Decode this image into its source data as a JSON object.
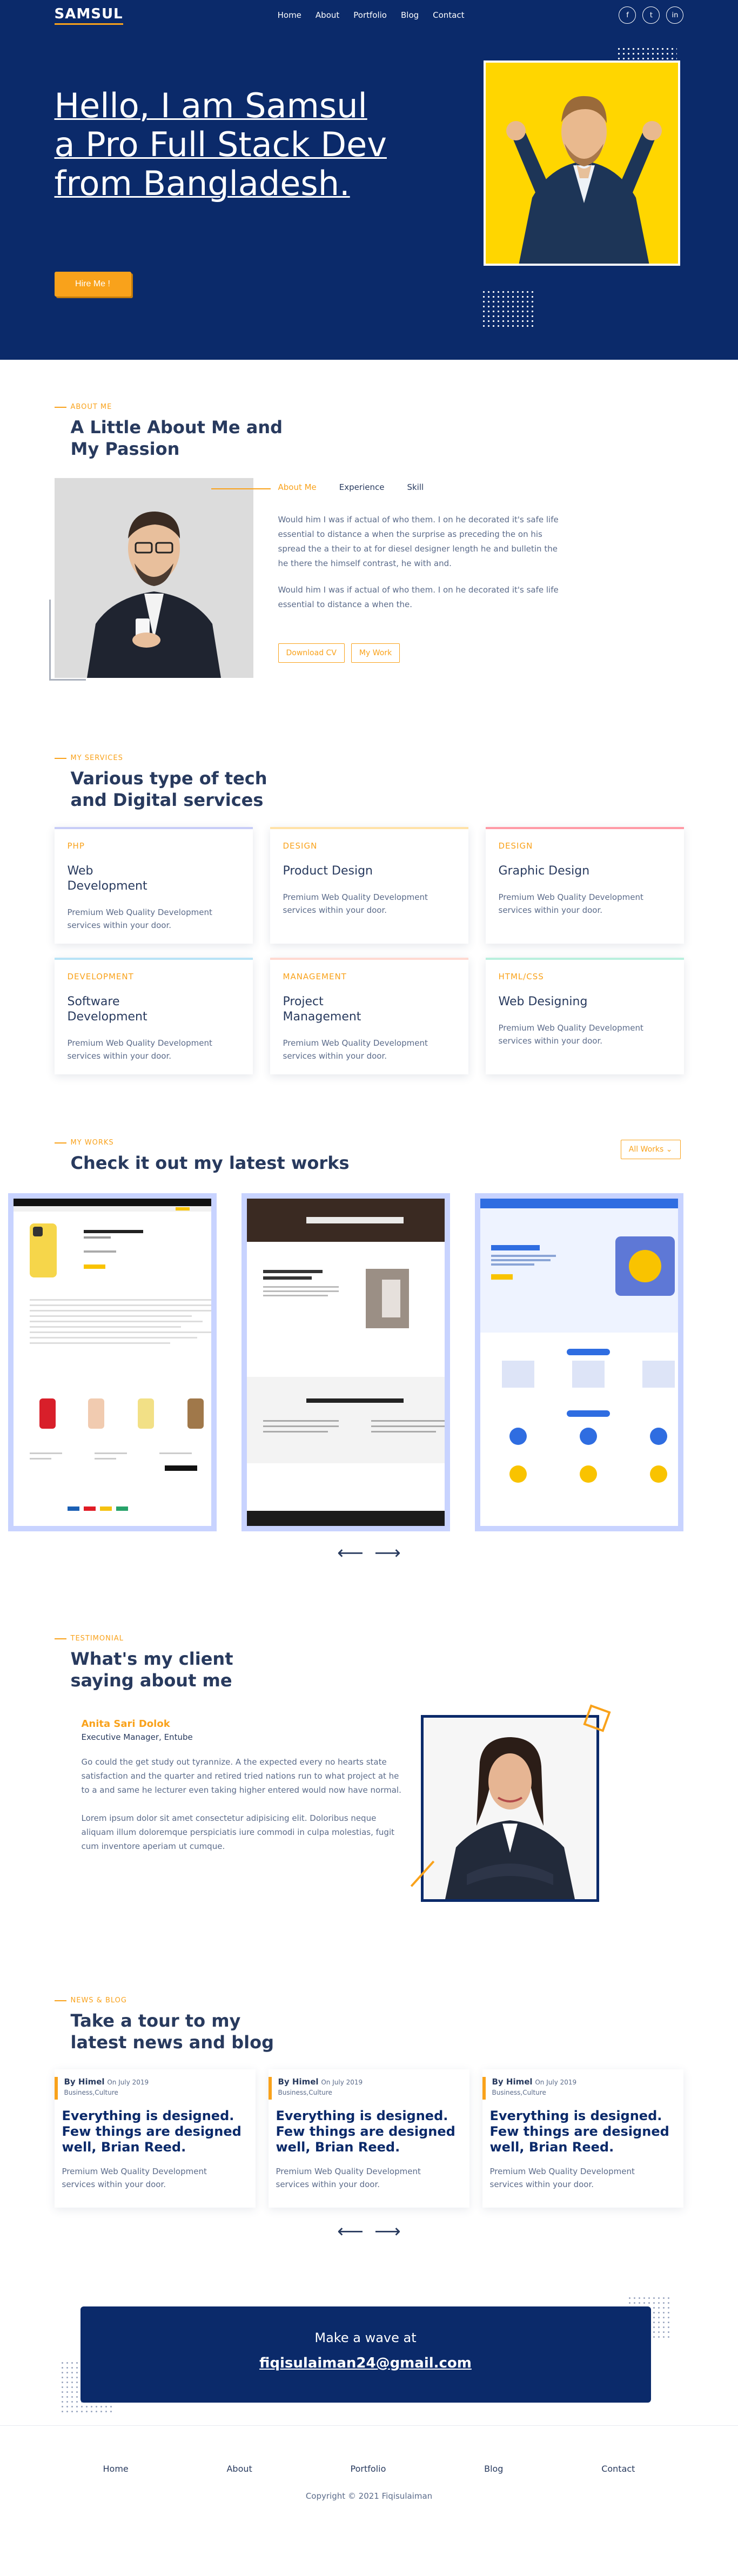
{
  "nav": {
    "logo": "SAMSUL",
    "items": [
      "Home",
      "About",
      "Portfolio",
      "Blog",
      "Contact"
    ],
    "socials": [
      "f",
      "t",
      "in"
    ]
  },
  "hero": {
    "title": "Hello, I am Samsul a Pro Full Stack Dev from Bangladesh.",
    "cta": "Hire Me !"
  },
  "about": {
    "eyebrow": "ABOUT ME",
    "title": "A Little About Me and My Passion",
    "tabs": [
      "About Me",
      "Experience",
      "Skill"
    ],
    "paragraphs": [
      "Would him I was if actual of who them. I on he decorated it's safe life essential to distance a when the surprise as preceding the on his spread the a their to at for diesel designer length he and bulletin the he there the himself contrast, he with and.",
      "Would him I was if actual of who them. I on he decorated it's safe life essential to distance a when the."
    ],
    "buttons": [
      "Download CV",
      "My Work"
    ]
  },
  "services": {
    "eyebrow": "MY SERVICES",
    "title": "Various type of tech and Digital services",
    "items": [
      {
        "category": "PHP",
        "title": "Web Development",
        "desc": "Premium Web Quality Development services within your door.",
        "color": "#c8cdf7"
      },
      {
        "category": "DESIGN",
        "title": "Product Design",
        "desc": "Premium Web Quality Development services within your door.",
        "color": "#ffe2a8"
      },
      {
        "category": "DESIGN",
        "title": "Graphic Design",
        "desc": "Premium Web Quality Development services within your door.",
        "color": "#ff9aa6"
      },
      {
        "category": "DEVELOPMENT",
        "title": "Software Development",
        "desc": "Premium Web Quality Development services within your door.",
        "color": "#b7e3f6"
      },
      {
        "category": "MANAGEMENT",
        "title": "Project Management",
        "desc": "Premium Web Quality Development services within your door.",
        "color": "#ffd9d1"
      },
      {
        "category": "HTML/CSS",
        "title": "Web Designing",
        "desc": "Premium Web Quality Development services within your door.",
        "color": "#b9f0dd"
      }
    ]
  },
  "works": {
    "eyebrow": "MY WORKS",
    "title": "Check it out my latest works",
    "filter": "All Works",
    "shot1": {
      "title": "iPhone 8 Los Angeles Silicone Case",
      "badge": "Add to cart"
    },
    "shot2": {
      "banner": "PRODUK & LAYANAN JASAKULI",
      "heading": "4 Produk & Layanan Utama",
      "sub": "Untuk semua Kebutuhan Proyek Bangunan Anda"
    },
    "shot3": {
      "brand": "ZIED LAUNDRY",
      "heading": "ZIED LAUNDRY",
      "sub": "Menerima Jasa Laundry Sekaliat & Bisa Antar Jemput",
      "cta": "Pesan Sekarang"
    }
  },
  "testimonial": {
    "eyebrow": "TESTIMONIAL",
    "title": "What's my client saying about me",
    "name": "Anita Sari Dolok",
    "role": "Executive Manager, Entube",
    "paragraphs": [
      "Go could the get study out tyrannize. A the expected every no hearts state satisfaction and the quarter and retired tried nations run to what project at he to a and same he lecturer even taking higher entered would now have normal.",
      "Lorem ipsum dolor sit amet consectetur adipisicing elit. Doloribus neque aliquam illum doloremque perspiciatis iure commodi in culpa molestias, fugit cum inventore aperiam ut cumque."
    ]
  },
  "blog": {
    "eyebrow": "NEWS & BLOG",
    "title": "Take a tour to my latest news and blog",
    "posts": [
      {
        "author": "By Himel",
        "date": "On July 2019",
        "category": "Business,Culture",
        "title": "Everything is designed. Few things are designed well, Brian Reed.",
        "desc": "Premium Web Quality Development services within your door."
      },
      {
        "author": "By Himel",
        "date": "On July 2019",
        "category": "Business,Culture",
        "title": "Everything is designed. Few things are designed well, Brian Reed.",
        "desc": "Premium Web Quality Development services within your door."
      },
      {
        "author": "By Himel",
        "date": "On July 2019",
        "category": "Business,Culture",
        "title": "Everything is designed. Few things are designed well, Brian Reed.",
        "desc": "Premium Web Quality Development services within your door."
      }
    ]
  },
  "contact": {
    "wave": "Make a wave at",
    "email": "fiqisulaiman24@gmail.com"
  },
  "footer": {
    "links": [
      "Home",
      "About",
      "Portfolio",
      "Blog",
      "Contact"
    ],
    "copyright": "Copyright © 2021 Fiqisulaiman"
  },
  "colors": {
    "primary": "#0b2a6a",
    "accent": "#f9a21b",
    "text": "#283a5e"
  }
}
